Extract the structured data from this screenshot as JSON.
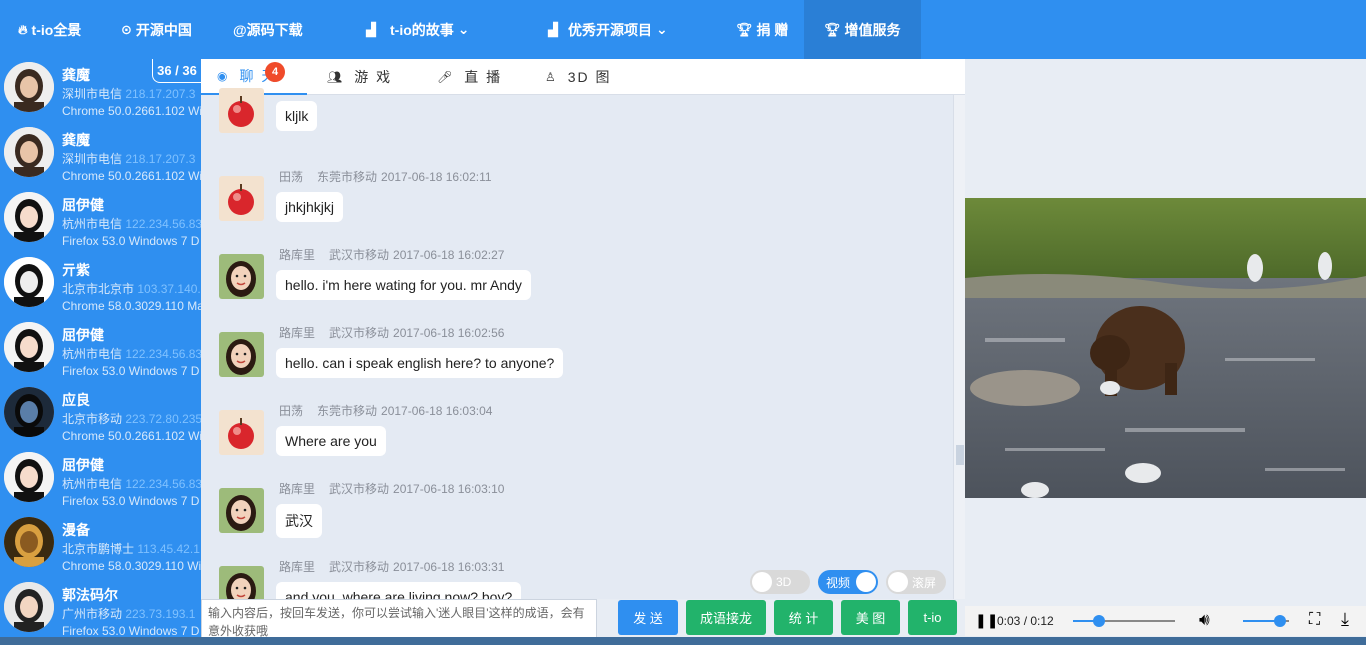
{
  "nav": {
    "items": [
      {
        "icon": "fire-icon",
        "label": "t-io全景"
      },
      {
        "icon": "github-icon",
        "label": "开源中国"
      },
      {
        "icon": "at-icon",
        "label": "@源码下载"
      },
      {
        "icon": "chart-icon",
        "label": "t-io的故事"
      },
      {
        "icon": "chart-icon",
        "label": "优秀开源项目"
      },
      {
        "icon": "trophy-icon",
        "label": "捐 赠"
      },
      {
        "icon": "trophy-icon",
        "label": "增值服务"
      }
    ],
    "chevron": "⌄"
  },
  "user_count": "36 / 36",
  "users": [
    {
      "name": "龚魔",
      "loc": "深圳市电信",
      "ip": "218.17.207.3",
      "browser": "Chrome 50.0.2661.102 Wi"
    },
    {
      "name": "龚魔",
      "loc": "深圳市电信",
      "ip": "218.17.207.3",
      "browser": "Chrome 50.0.2661.102 Wi"
    },
    {
      "name": "屈伊健",
      "loc": "杭州市电信",
      "ip": "122.234.56.83",
      "browser": "Firefox 53.0 Windows 7 D"
    },
    {
      "name": "亓紫",
      "loc": "北京市北京市",
      "ip": "103.37.140.",
      "browser": "Chrome 58.0.3029.110 Ma"
    },
    {
      "name": "屈伊健",
      "loc": "杭州市电信",
      "ip": "122.234.56.83",
      "browser": "Firefox 53.0 Windows 7 D"
    },
    {
      "name": "应良",
      "loc": "北京市移动",
      "ip": "223.72.80.235",
      "browser": "Chrome 50.0.2661.102 Wi"
    },
    {
      "name": "屈伊健",
      "loc": "杭州市电信",
      "ip": "122.234.56.83",
      "browser": "Firefox 53.0 Windows 7 D"
    },
    {
      "name": "漫备",
      "loc": "北京市鹏博士",
      "ip": "113.45.42.1",
      "browser": "Chrome 58.0.3029.110 Wi"
    },
    {
      "name": "郭法码尔",
      "loc": "广州市移动",
      "ip": "223.73.193.1",
      "browser": "Firefox 53.0 Windows 7 D"
    }
  ],
  "tabs": [
    {
      "label": "聊 天",
      "icon": "chat-icon"
    },
    {
      "label": "游 戏",
      "icon": "users-icon"
    },
    {
      "label": "直 播",
      "icon": "mic-icon"
    },
    {
      "label": "3D 图",
      "icon": "penguin-icon"
    }
  ],
  "badge": "4",
  "messages": [
    {
      "name": "",
      "loc": "",
      "time": "",
      "text": "kljlk",
      "avatar": "apple"
    },
    {
      "name": "田荡",
      "loc": "东莞市移动",
      "time": "2017-06-18 16:02:11",
      "text": "jhkjhkjkj",
      "avatar": "apple"
    },
    {
      "name": "路库里",
      "loc": "武汉市移动",
      "time": "2017-06-18 16:02:27",
      "text": "hello. i'm here wating for you. mr Andy",
      "avatar": "girl"
    },
    {
      "name": "路库里",
      "loc": "武汉市移动",
      "time": "2017-06-18 16:02:56",
      "text": "hello. can i speak english here? to anyone?",
      "avatar": "girl"
    },
    {
      "name": "田荡",
      "loc": "东莞市移动",
      "time": "2017-06-18 16:03:04",
      "text": "Where are you",
      "avatar": "apple"
    },
    {
      "name": "路库里",
      "loc": "武汉市移动",
      "time": "2017-06-18 16:03:10",
      "text": "武汉",
      "avatar": "girl"
    },
    {
      "name": "路库里",
      "loc": "武汉市移动",
      "time": "2017-06-18 16:03:31",
      "text": "and you. where are living now? boy?",
      "avatar": "girl"
    }
  ],
  "toggles": [
    {
      "label": "3D",
      "on": false
    },
    {
      "label": "视频",
      "on": true
    },
    {
      "label": "滚屏",
      "on": false
    }
  ],
  "input": {
    "placeholder": "输入内容后，按回车发送，你可以尝试输入'迷人眼目'这样的成语，会有意外收获哦"
  },
  "buttons": [
    {
      "label": "发 送",
      "color": "blue"
    },
    {
      "label": "成语接龙",
      "color": "green"
    },
    {
      "label": "统 计",
      "color": "green"
    },
    {
      "label": "美 图",
      "color": "green"
    },
    {
      "label": "t-io",
      "color": "green"
    }
  ],
  "video": {
    "time": "0:03 / 0:12",
    "progress": 0.25,
    "volume": 0.8
  },
  "colors": {
    "accent": "#2f8ff0",
    "green": "#22b36b",
    "badge": "#f04b2a"
  }
}
